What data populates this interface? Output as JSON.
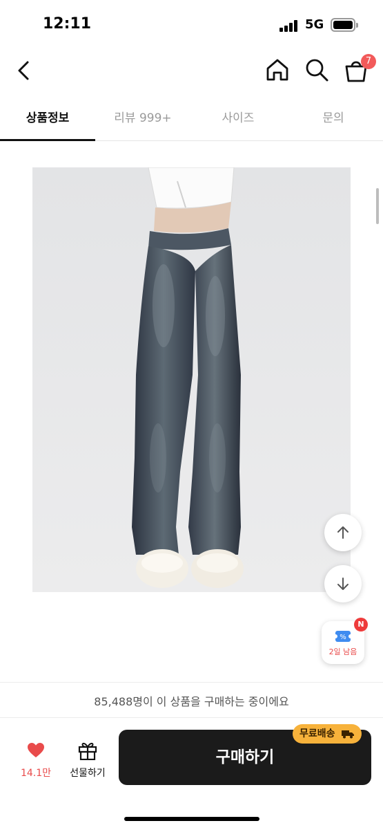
{
  "status_bar": {
    "time": "12:11",
    "network": "5G"
  },
  "header": {
    "cart_count": "7"
  },
  "tabs": [
    {
      "label": "상품정보",
      "active": true
    },
    {
      "label": "리뷰 999+",
      "active": false
    },
    {
      "label": "사이즈",
      "active": false
    },
    {
      "label": "문의",
      "active": false
    }
  ],
  "floating": {
    "coupon_label": "2일 남음",
    "coupon_badge": "N"
  },
  "purchase_bar": {
    "buyers_info": "85,488명이 이 상품을 구매하는 중이에요",
    "like_count": "14.1만",
    "gift_label": "선물하기",
    "buy_label": "구매하기",
    "free_shipping_label": "무료배송"
  },
  "colors": {
    "accent_red": "#e94b4b",
    "badge_orange": "#f7b23b",
    "buy_button": "#1b1b1b"
  },
  "icons": [
    "back-icon",
    "home-icon",
    "search-icon",
    "cart-icon",
    "arrow-up-icon",
    "arrow-down-icon",
    "coupon-icon",
    "heart-icon",
    "gift-icon",
    "truck-icon"
  ]
}
